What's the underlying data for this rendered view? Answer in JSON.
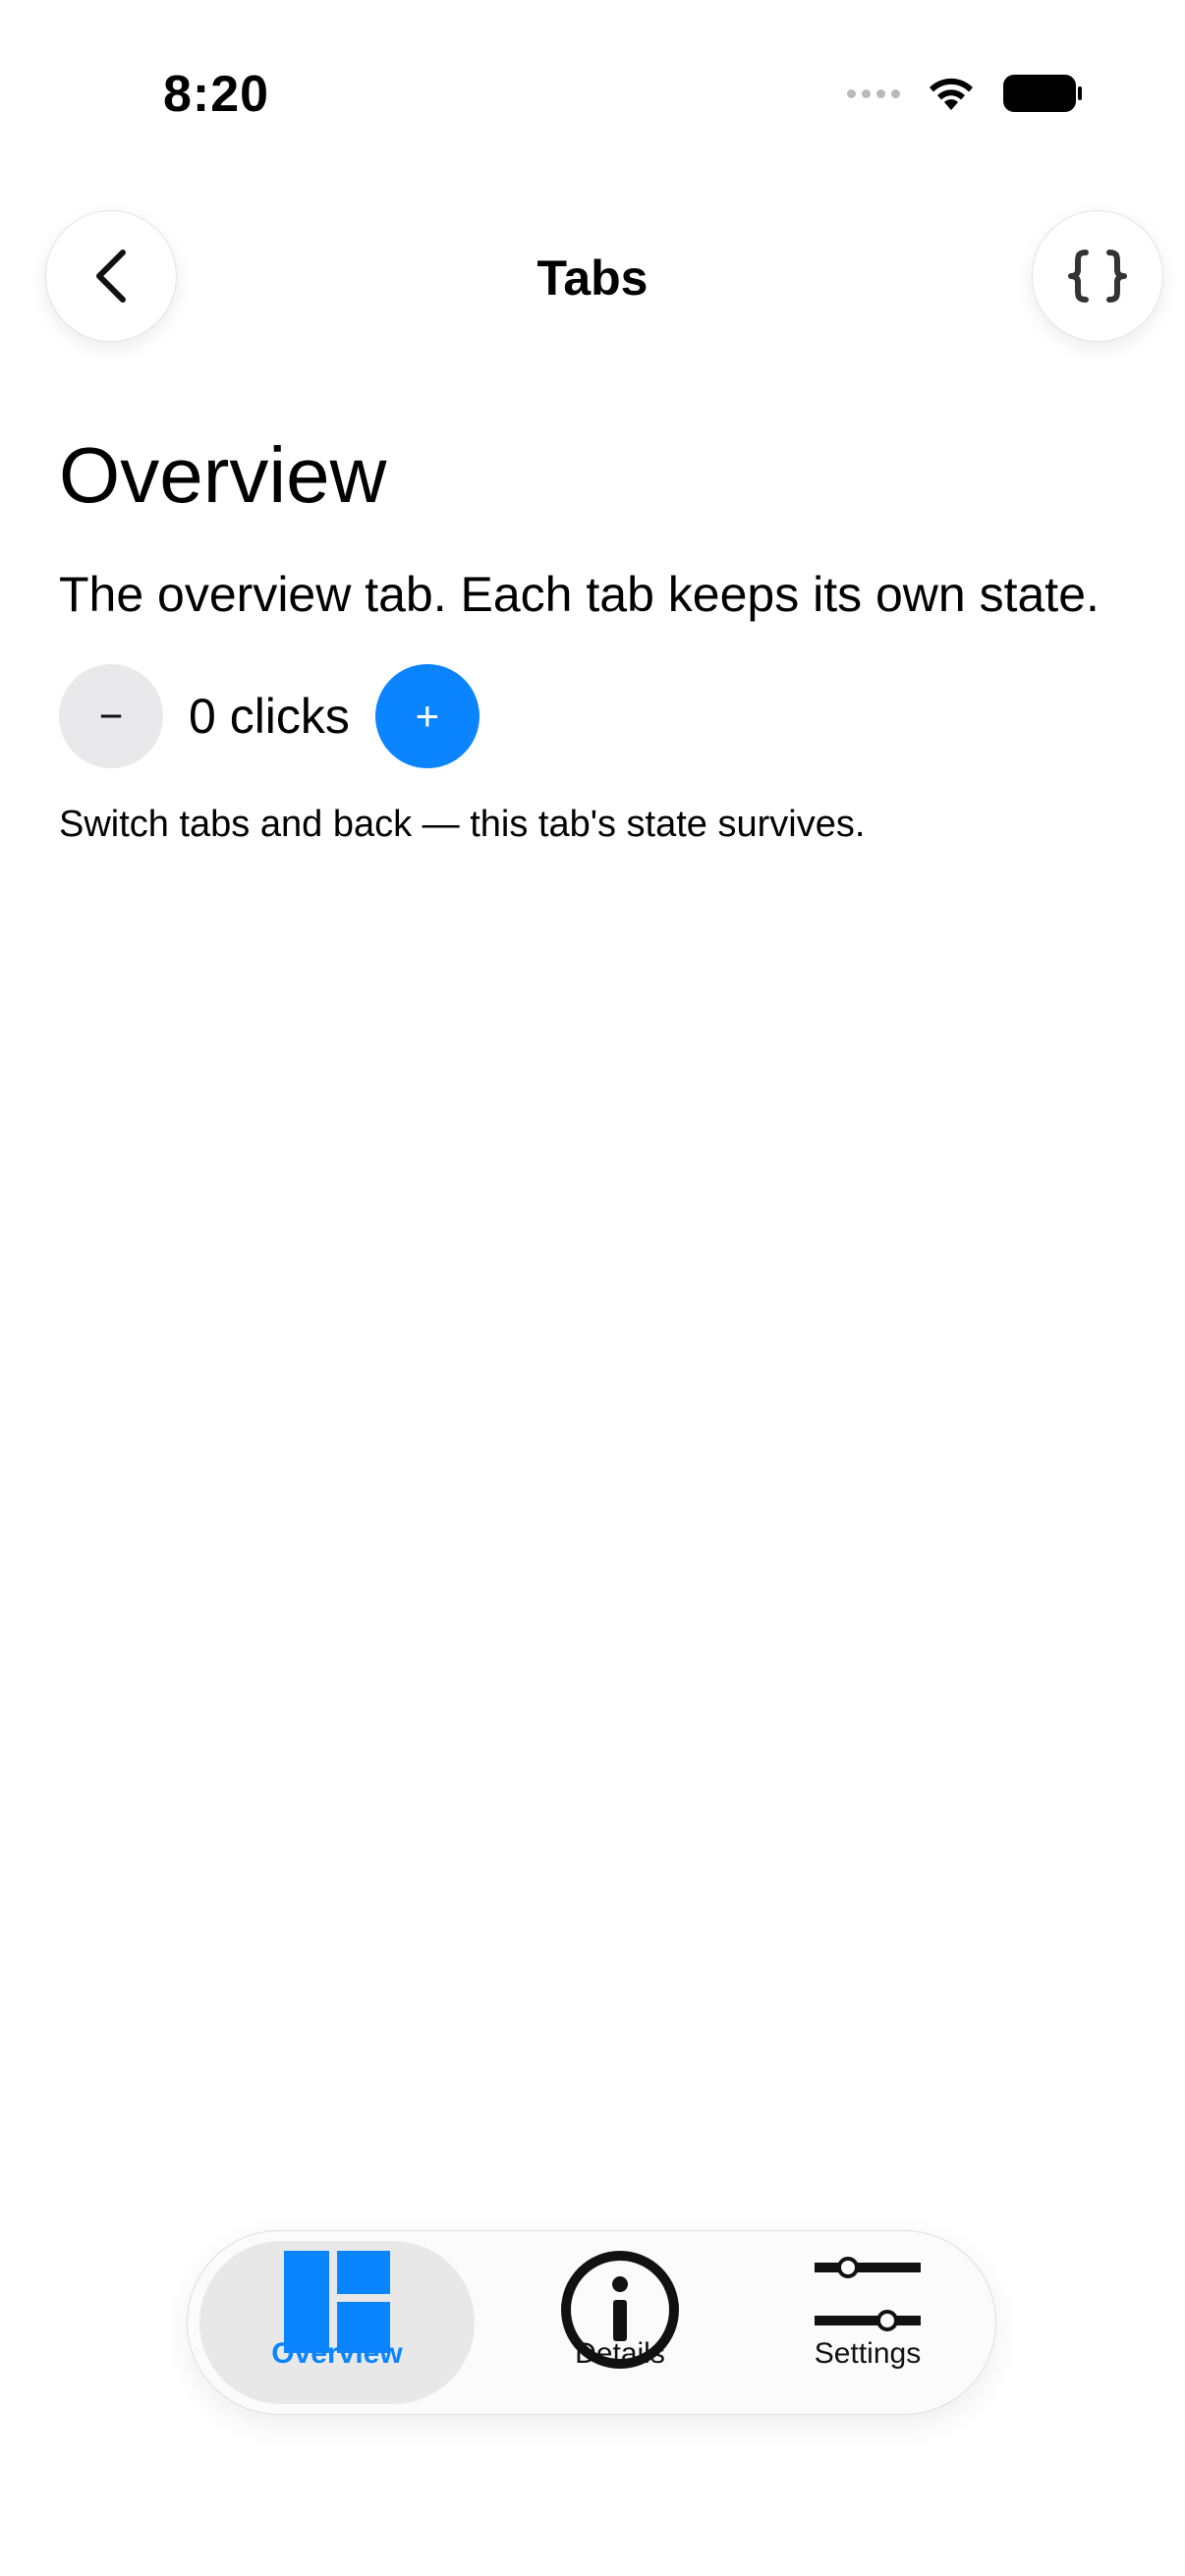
{
  "status_bar": {
    "time": "8:20"
  },
  "nav": {
    "title": "Tabs",
    "back_icon": "chevron-left-icon",
    "right_icon": "curly-braces-icon"
  },
  "content": {
    "heading": "Overview",
    "description": "The overview tab. Each tab keeps its own state.",
    "counter": {
      "minus_label": "−",
      "count_text": "0 clicks",
      "plus_label": "+"
    },
    "hint": "Switch tabs and back — this tab's state survives."
  },
  "tab_bar": {
    "tabs": [
      {
        "label": "Overview",
        "icon": "sidebar-layout-icon",
        "selected": true
      },
      {
        "label": "Details",
        "icon": "info-circle-icon",
        "selected": false
      },
      {
        "label": "Settings",
        "icon": "sliders-icon",
        "selected": false
      }
    ]
  },
  "colors": {
    "accent": "#0a84ff",
    "minus_button_bg": "#e9e9ec",
    "selected_tab_bg": "#e8e8e8"
  }
}
